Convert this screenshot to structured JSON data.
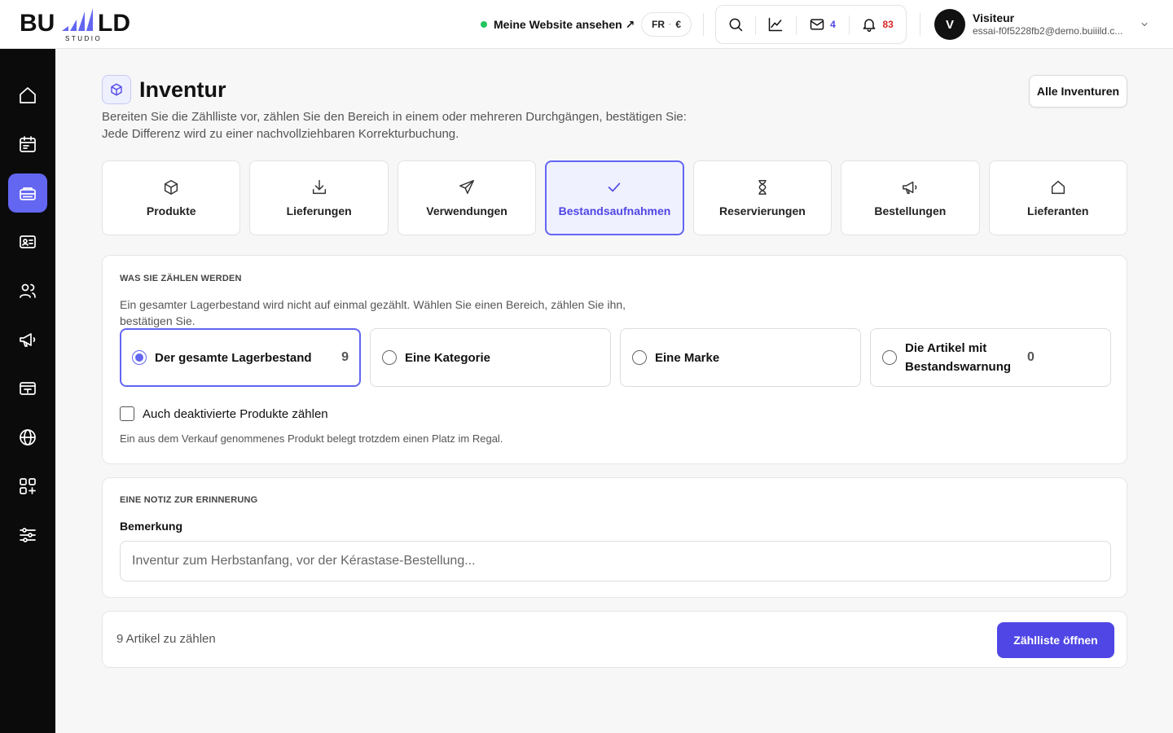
{
  "brand": {
    "logo_text": "BUIILD",
    "logo_sub": "STUDIO"
  },
  "topbar": {
    "live_link": "Meine Website ansehen ↗",
    "locale": {
      "language": "FR",
      "currency": "€"
    },
    "mail_count": "4",
    "notification_count": "83",
    "user": {
      "initial": "V",
      "name": "Visiteur",
      "email": "essai-f0f5228fb2@demo.buiiild.c..."
    }
  },
  "sidebar": {
    "items": [
      {
        "name": "home",
        "active": false
      },
      {
        "name": "calendar",
        "active": false
      },
      {
        "name": "inventory",
        "active": true
      },
      {
        "name": "contact-card",
        "active": false
      },
      {
        "name": "users",
        "active": false
      },
      {
        "name": "megaphone",
        "active": false
      },
      {
        "name": "register",
        "active": false
      },
      {
        "name": "globe",
        "active": false
      },
      {
        "name": "apps",
        "active": false
      },
      {
        "name": "settings",
        "active": false
      }
    ]
  },
  "page": {
    "title": "Inventur",
    "description": "Bereiten Sie die Zählliste vor, zählen Sie den Bereich in einem oder mehreren Durchgängen, bestätigen Sie: Jede Differenz wird zu einer nachvollziehbaren Korrekturbuchung.",
    "all_button": "Alle Inventuren"
  },
  "tabs": [
    {
      "label": "Produkte",
      "icon": "box-icon",
      "active": false
    },
    {
      "label": "Lieferungen",
      "icon": "download-icon",
      "active": false
    },
    {
      "label": "Verwendungen",
      "icon": "send-icon",
      "active": false
    },
    {
      "label": "Bestandsaufnahmen",
      "icon": "check-icon",
      "active": true
    },
    {
      "label": "Reservierungen",
      "icon": "hourglass-icon",
      "active": false
    },
    {
      "label": "Bestellungen",
      "icon": "megaphone-icon",
      "active": false
    },
    {
      "label": "Lieferanten",
      "icon": "house-icon",
      "active": false
    }
  ],
  "scope": {
    "section_label": "Was Sie zählen werden",
    "description": "Ein gesamter Lagerbestand wird nicht auf einmal gezählt. Wählen Sie einen Bereich, zählen Sie ihn, bestätigen Sie.",
    "options": [
      {
        "label": "Der gesamte Lagerbestand",
        "count": "9",
        "selected": true
      },
      {
        "label": "Eine Kategorie",
        "count": "",
        "selected": false
      },
      {
        "label": "Eine Marke",
        "count": "",
        "selected": false
      },
      {
        "label": "Die Artikel mit Bestandswarnung",
        "count": "0",
        "selected": false
      }
    ],
    "include_disabled_label": "Auch deaktivierte Produkte zählen",
    "include_disabled_checked": false,
    "include_disabled_hint": "Ein aus dem Verkauf genommenes Produkt belegt trotzdem einen Platz im Regal."
  },
  "note": {
    "section_label": "Eine Notiz zur Erinnerung",
    "field_label": "Bemerkung",
    "value": "",
    "placeholder": "Inventur zum Herbstanfang, vor der Kérastase-Bestellung..."
  },
  "footer": {
    "count_text": "9 Artikel zu zählen",
    "open_button": "Zählliste öffnen"
  },
  "colors": {
    "accent": "#4f46e5",
    "accent_light": "#6366f1",
    "live": "#22c55e",
    "alert": "#dc2626",
    "sidebar": "#0b0b0c"
  }
}
